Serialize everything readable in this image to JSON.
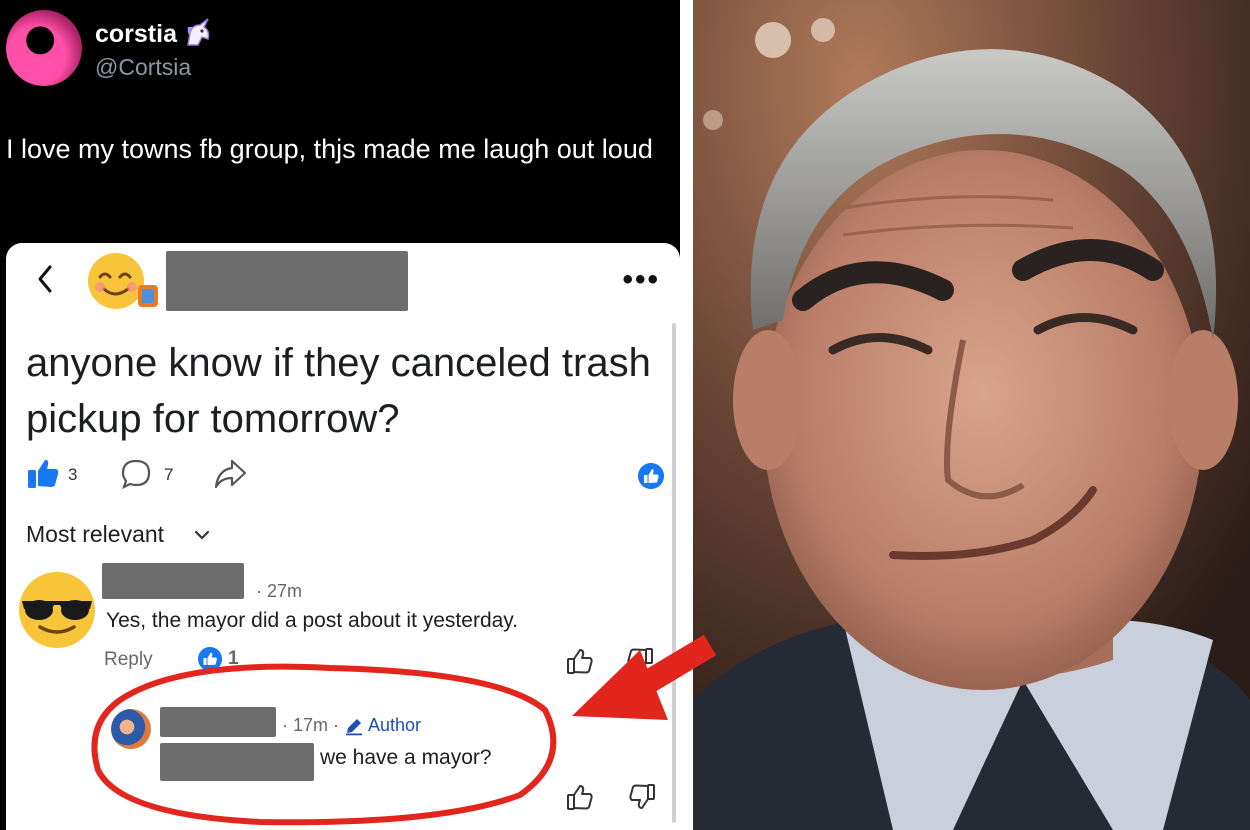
{
  "tweet": {
    "display_name": "corstia",
    "badge_icon": "unicorn-icon",
    "handle": "@Cortsia",
    "text": "I love my towns fb group, thjs made me laugh out loud"
  },
  "fb_post": {
    "title": "anyone know if they canceled trash pickup for tomorrow?",
    "like_count": "3",
    "comment_count": "7",
    "sort_label": "Most relevant",
    "comment": {
      "time": "· 27m",
      "text": "Yes, the mayor did a post about it yesterday.",
      "reply_label": "Reply",
      "reaction_count": "1"
    },
    "reply": {
      "time": "· 17m ·",
      "author_label": "Author",
      "text": "we have a mayor?"
    }
  },
  "colors": {
    "accent_blue": "#1877f2",
    "annotation_red": "#e3261d"
  }
}
